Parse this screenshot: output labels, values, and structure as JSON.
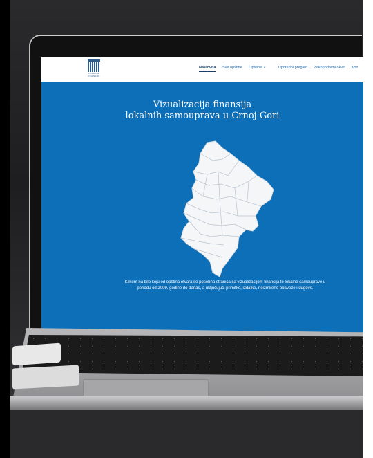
{
  "nav": {
    "logo_text": "LOKALNE FINANSIJE",
    "items": [
      {
        "label": "Naslovna",
        "active": true
      },
      {
        "label": "Sve opštine"
      },
      {
        "label": "Opštine",
        "dropdown": true
      },
      {
        "label": "Uporedni pregled"
      },
      {
        "label": "Zakonodavni okvir"
      },
      {
        "label": "Kon"
      }
    ]
  },
  "hero": {
    "title_line1": "Vizualizacija finansija",
    "title_line2": "lokalnih samouprava u Crnoj Gori",
    "caption": "Klikom na bilo koju od opština otvara se posebna stranica sa vizualizacijom finansija te lokalne samouprave u periodu od 2009. godine do danas, a uključujući primitke, izdatke, neizmirene obaveze i dugove."
  },
  "colors": {
    "screen_bg": "#0d6fb8",
    "map_fill": "#f4f6f8",
    "nav_link": "#2f6fa8"
  }
}
